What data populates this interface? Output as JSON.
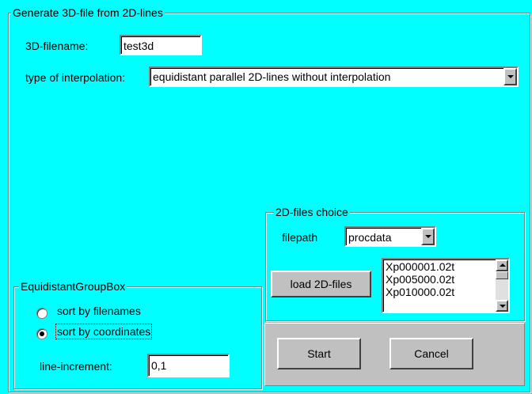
{
  "main_group": {
    "title": "Generate 3D-file from 2D-lines",
    "filename_label": "3D-filename:",
    "filename_value": "test3d",
    "interpolation_label": "type of interpolation:",
    "interpolation_value": "equidistant parallel 2D-lines without interpolation"
  },
  "files_group": {
    "title": "2D-files choice",
    "filepath_label": "filepath",
    "filepath_value": "procdata",
    "load_button": "load 2D-files",
    "files": [
      "Xp000001.02t",
      "Xp005000.02t",
      "Xp010000.02t"
    ]
  },
  "equidistant_group": {
    "title": "EquidistantGroupBox",
    "radio_filenames": "sort by filenames",
    "radio_coordinates": "sort by coordinates",
    "selected": "sort by coordinates",
    "increment_label": "line-increment:",
    "increment_value": "0,1"
  },
  "actions": {
    "start": "Start",
    "cancel": "Cancel"
  },
  "icons": {
    "dropdown": "chevron-down-icon",
    "scroll_up": "scroll-up-icon",
    "scroll_down": "scroll-down-icon"
  },
  "colors": {
    "background": "#00FFFF",
    "panel": "#C0C0C0"
  }
}
